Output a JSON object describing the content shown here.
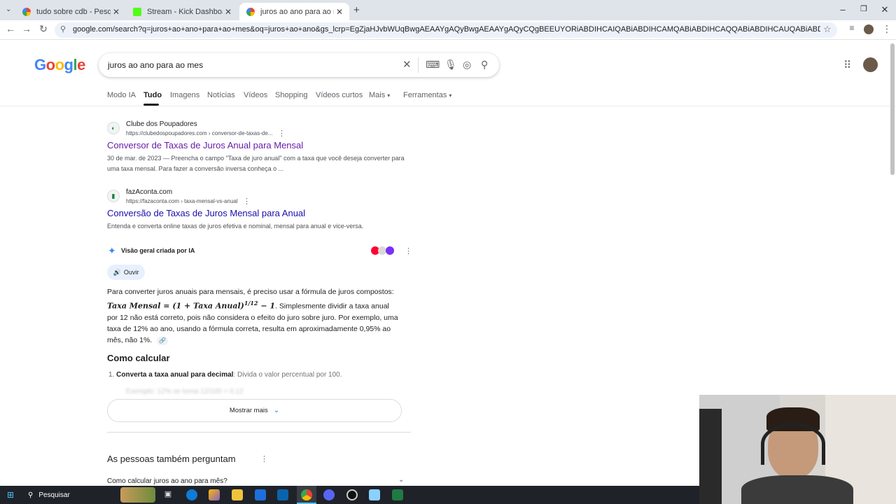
{
  "browser": {
    "tabs": [
      {
        "title": "tudo sobre cdb - Pesquisa Goo",
        "active": false
      },
      {
        "title": "Stream - Kick Dashboard",
        "active": false
      },
      {
        "title": "juros ao ano para ao mes - Pes",
        "active": true
      }
    ],
    "url": "google.com/search?q=juros+ao+ano+para+ao+mes&oq=juros+ao+ano&gs_lcrp=EgZjaHJvbWUqBwgAEAAYgAQyBwgAEAAYgAQyCQgBEEUYORiABDIHCAIQABiABDIHCAMQABiABDIHCAQQABiABDIHCAUQABiABDIHCAYQABiABDIMCAcQABgUGIcCGIAEMgc..."
  },
  "google": {
    "logo": "Google",
    "query": "juros ao ano para ao mes",
    "nav": {
      "tabs": [
        "Modo IA",
        "Tudo",
        "Imagens",
        "Notícias",
        "Vídeos",
        "Shopping",
        "Vídeos curtos",
        "Mais",
        "Ferramentas"
      ],
      "active": "Tudo"
    }
  },
  "results": [
    {
      "site": "Clube dos Poupadores",
      "crumb": "https://clubedospoupadores.com › conversor-de-taxas-de...",
      "title": "Conversor de Taxas de Juros Anual para Mensal",
      "visited": true,
      "snippet": "30 de mar. de 2023 — Preencha o campo \"Taxa de juro anual\" com a taxa que você deseja converter para uma taxa mensal. Para fazer a conversão inversa conheça o ..."
    },
    {
      "site": "fazAconta.com",
      "crumb": "https://fazaconta.com › taxa-mensal-vs-anual",
      "title": "Conversão de Taxas de Juros Mensal para Anual",
      "visited": false,
      "snippet": "Entenda e converta online taxas de juros efetiva e nominal, mensal para anual e vice-versa."
    }
  ],
  "ai_overview": {
    "label": "Visão geral criada por IA",
    "listen": "Ouvir",
    "text_a": "Para converter juros anuais para mensais, é preciso usar a fórmula de juros compostos: ",
    "formula": "Taxa Mensal = (1 + Taxa Anual)",
    "exponent": "1/12",
    "formula_tail": " − 1",
    "text_b": ". Simplesmente dividir a taxa anual por 12 não está correto, pois não considera o efeito do juro sobre juro. Por exemplo, uma taxa de 12% ao ano, usando a fórmula correta, resulta em aproximadamente 0,95% ao mês, não 1%.",
    "heading": "Como calcular",
    "step1_bold": "Converta a taxa anual para decimal",
    "step1_rest": ": Divida o valor percentual por 100.",
    "step2": "Exemplo: 12% se torna 12/100 = 0,12",
    "more": "Mostrar mais"
  },
  "paa": {
    "heading": "As pessoas também perguntam",
    "q1": "Como calcular juros ao ano para mês?"
  },
  "taskbar": {
    "search": "Pesquisar"
  }
}
